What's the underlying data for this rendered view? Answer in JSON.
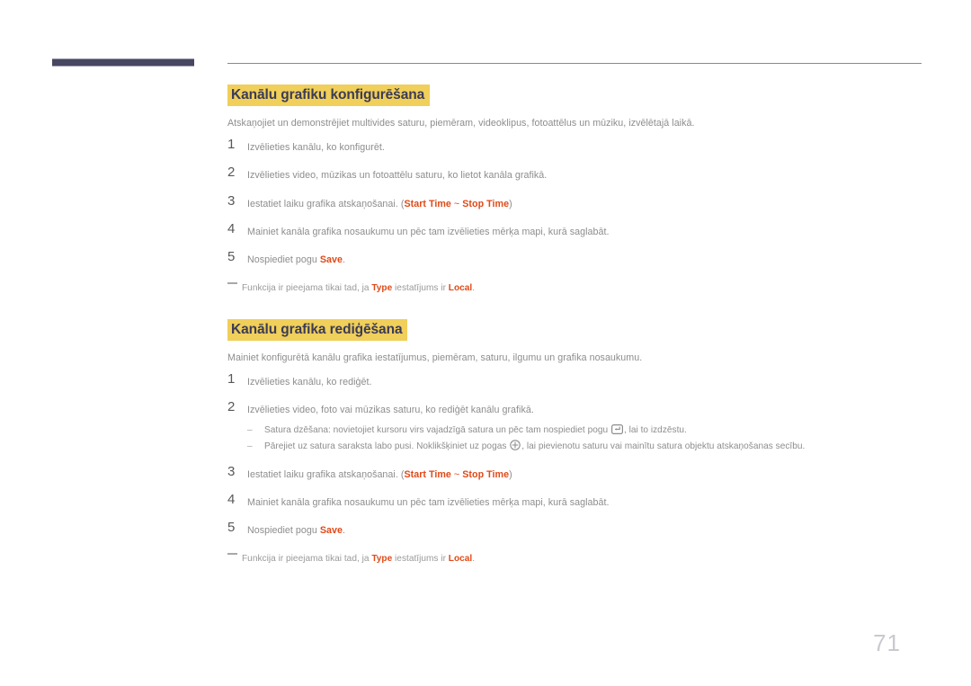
{
  "page": {
    "number": "71",
    "language": "lv"
  },
  "decoration": {
    "bar_color": "#474761",
    "rule_color": "#8a8a8a",
    "highlight_color": "#f0cf5a",
    "heading_color": "#3b3b55",
    "accent_color": "#e04a18",
    "body_color": "#8d8d8d"
  },
  "sections": [
    {
      "title": "Kanālu grafiku konfigurēšana",
      "intro": "Atskaņojiet un demonstrējiet multivides saturu, piemēram, videoklipus, fotoattēlus un mūziku, izvēlētajā laikā.",
      "steps": [
        {
          "number": "1",
          "parts": [
            {
              "type": "text",
              "value": "Izvēlieties kanālu, ko konfigurēt."
            }
          ]
        },
        {
          "number": "2",
          "parts": [
            {
              "type": "text",
              "value": "Izvēlieties video, mūzikas un fotoattēlu saturu, ko lietot kanāla grafikā."
            }
          ]
        },
        {
          "number": "3",
          "parts": [
            {
              "type": "text",
              "value": "Iestatiet laiku grafika atskaņošanai. ("
            },
            {
              "type": "term",
              "value": "Start Time"
            },
            {
              "type": "tilde",
              "value": " ~ "
            },
            {
              "type": "term",
              "value": "Stop Time"
            },
            {
              "type": "paren",
              "value": ")"
            }
          ]
        },
        {
          "number": "4",
          "parts": [
            {
              "type": "text",
              "value": "Mainiet kanāla grafika nosaukumu un pēc tam izvēlieties mērķa mapi, kurā saglabāt."
            }
          ]
        },
        {
          "number": "5",
          "parts": [
            {
              "type": "text",
              "value": "Nospiediet pogu "
            },
            {
              "type": "term",
              "value": "Save"
            },
            {
              "type": "text",
              "value": "."
            }
          ]
        }
      ],
      "note": {
        "parts": [
          {
            "type": "text",
            "value": "Funkcija ir pieejama tikai tad, ja "
          },
          {
            "type": "term",
            "value": "Type"
          },
          {
            "type": "text",
            "value": " iestatījums ir "
          },
          {
            "type": "term",
            "value": "Local"
          },
          {
            "type": "text",
            "value": "."
          }
        ]
      }
    },
    {
      "title": "Kanālu grafika rediģēšana",
      "intro": "Mainiet konfigurētā kanālu grafika iestatījumus, piemēram, saturu, ilgumu un grafika nosaukumu.",
      "steps": [
        {
          "number": "1",
          "parts": [
            {
              "type": "text",
              "value": "Izvēlieties kanālu, ko rediģēt."
            }
          ]
        },
        {
          "number": "2",
          "parts": [
            {
              "type": "text",
              "value": "Izvēlieties video, foto vai mūzikas saturu, ko rediģēt kanālu grafikā."
            }
          ],
          "subs": [
            {
              "parts": [
                {
                  "type": "text",
                  "value": "Satura dzēšana: novietojiet kursoru virs vajadzīgā satura un pēc tam nospiediet pogu "
                },
                {
                  "type": "icon",
                  "value": "enter-key-icon"
                },
                {
                  "type": "text",
                  "value": ", lai to izdzēstu."
                }
              ]
            },
            {
              "parts": [
                {
                  "type": "text",
                  "value": "Pārejiet uz satura saraksta labo pusi. Noklikšķiniet uz pogas "
                },
                {
                  "type": "icon",
                  "value": "circle-plus-icon"
                },
                {
                  "type": "text",
                  "value": ", lai pievienotu saturu vai mainītu satura objektu atskaņošanas secību."
                }
              ]
            }
          ]
        },
        {
          "number": "3",
          "parts": [
            {
              "type": "text",
              "value": "Iestatiet laiku grafika atskaņošanai. ("
            },
            {
              "type": "term",
              "value": "Start Time"
            },
            {
              "type": "tilde",
              "value": " ~ "
            },
            {
              "type": "term",
              "value": "Stop Time"
            },
            {
              "type": "paren",
              "value": ")"
            }
          ]
        },
        {
          "number": "4",
          "parts": [
            {
              "type": "text",
              "value": "Mainiet kanāla grafika nosaukumu un pēc tam izvēlieties mērķa mapi, kurā saglabāt."
            }
          ]
        },
        {
          "number": "5",
          "parts": [
            {
              "type": "text",
              "value": "Nospiediet pogu "
            },
            {
              "type": "term",
              "value": "Save"
            },
            {
              "type": "text",
              "value": "."
            }
          ]
        }
      ],
      "note": {
        "parts": [
          {
            "type": "text",
            "value": "Funkcija ir pieejama tikai tad, ja "
          },
          {
            "type": "term",
            "value": "Type"
          },
          {
            "type": "text",
            "value": " iestatījums ir "
          },
          {
            "type": "term",
            "value": "Local"
          },
          {
            "type": "text",
            "value": "."
          }
        ]
      }
    }
  ]
}
